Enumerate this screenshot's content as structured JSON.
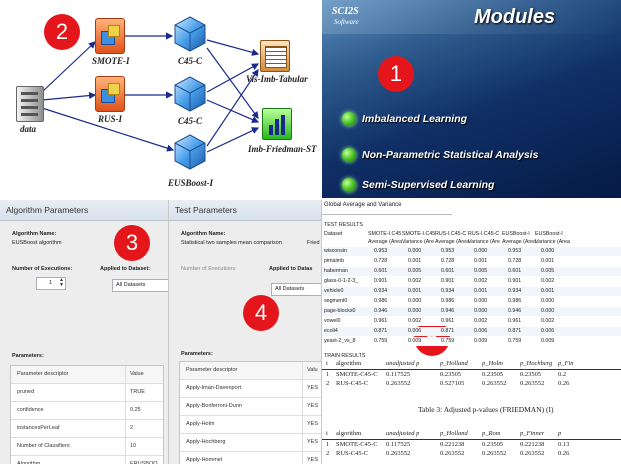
{
  "badges": [
    "2",
    "1",
    "3",
    "4",
    "5"
  ],
  "workflow": {
    "nodes": {
      "data": "data",
      "smote": "SMOTE-I",
      "rus": "RUS-I",
      "c45_top": "C45-C",
      "c45_mid": "C45-C",
      "eusboost": "EUSBoost-I",
      "vis_tabular": "Vis-Imb-Tabular",
      "friedman": "Imb-Friedman-ST"
    }
  },
  "modules": {
    "logo_line1": "SCI2S",
    "logo_line2": "Software",
    "title": "Modules",
    "items": [
      "Imbalanced Learning",
      "Non-Parametric Statistical Analysis",
      "Semi-Supervised Learning"
    ],
    "colors": {
      "bg": "#0f2f66",
      "dot": "#52c92a"
    }
  },
  "algo_dialog": {
    "title": "Algorithm Parameters",
    "name_label": "Algorithm Name:",
    "name_value": "EUSBoost algorithm",
    "executions_label": "Number of Executions:",
    "executions_value": "1",
    "applied_label": "Applied to Dataset:",
    "applied_value": "All Datasets",
    "params_label": "Parameters:",
    "headers": [
      "Parameter descriptor",
      "Value"
    ],
    "rows": [
      [
        "pruned",
        "TRUE"
      ],
      [
        "confidence",
        "0.25"
      ],
      [
        "instancesPerLeaf",
        "2"
      ],
      [
        "Number of Classifiers",
        "10"
      ],
      [
        "Algorithm",
        "ERUSBOO"
      ]
    ]
  },
  "test_dialog": {
    "title": "Test Parameters",
    "name_label": "Algorithm Name:",
    "name_value": "Statistical two samples mean comparison",
    "name_value_cut": "Fried",
    "executions_label": "Number of Executions:",
    "applied_label": "Applied to Datas",
    "applied_value": "All Datasets",
    "params_label": "Parameters:",
    "headers": [
      "Parameter descriptor",
      "Valu"
    ],
    "rows": [
      [
        "Apply-Iman-Davenport",
        "YES"
      ],
      [
        "Apply-Bonferroni-Dunn",
        "YES"
      ],
      [
        "Apply-Holm",
        "YES"
      ],
      [
        "Apply-Hochberg",
        "YES"
      ],
      [
        "Apply-Hommel",
        "YES"
      ]
    ]
  },
  "results": {
    "title": "Global Average and Variance",
    "test_results_label": "TEST RESULTS",
    "header1": [
      "Dataset",
      "SMOTE-I.C45",
      "SMOTE-I.C45",
      "RUS-I.C45-C",
      "RUS-I.C45-C",
      "EUSBoost-I",
      "EUSBoost-I"
    ],
    "header2": [
      "",
      "Average (Area",
      "Variance (Are",
      "Average (Area",
      "Variance (Are",
      "Average (Area",
      "Variance (Area"
    ],
    "rows": [
      [
        "wisconsin",
        "0.953",
        "0.000",
        "0.953",
        "0.000",
        "0.953",
        "0.000"
      ],
      [
        "pimaimb",
        "0.728",
        "0.001",
        "0.728",
        "0.001",
        "0.728",
        "0.001"
      ],
      [
        "haberman",
        "0.601",
        "0.005",
        "0.601",
        "0.005",
        "0.601",
        "0.005"
      ],
      [
        "glass-0-1-2-3_",
        "0.901",
        "0.002",
        "0.901",
        "0.002",
        "0.901",
        "0.002"
      ],
      [
        "vehicle0",
        "0.934",
        "0.001",
        "0.934",
        "0.001",
        "0.934",
        "0.001"
      ],
      [
        "segment0",
        "0.986",
        "0.000",
        "0.986",
        "0.000",
        "0.986",
        "0.000"
      ],
      [
        "page-blocks0",
        "0.946",
        "0.000",
        "0.946",
        "0.000",
        "0.946",
        "0.000"
      ],
      [
        "vowel0",
        "0.961",
        "0.002",
        "0.961",
        "0.002",
        "0.961",
        "0.002"
      ],
      [
        "ecoli4",
        "0.871",
        "0.006",
        "0.871",
        "0.006",
        "0.871",
        "0.006"
      ],
      [
        "yeast-2_vs_8",
        "0.759",
        "0.009",
        "0.759",
        "0.009",
        "0.759",
        "0.009"
      ]
    ],
    "train_label": "TRAIN RESULTS",
    "table_a_header": [
      "i",
      "algorithm",
      "unadjusted p",
      "p_Holland",
      "p_Holm",
      "p_Hochberg",
      "p_Fin"
    ],
    "table_a_rows": [
      [
        "1",
        "SMOTE-C45-C",
        "0.117525",
        "0.23505",
        "0.23505",
        "0.23505",
        "0.2"
      ],
      [
        "2",
        "RUS-C45-C",
        "0.263552",
        "0.527105",
        "0.263552",
        "0.263552",
        "0.26"
      ]
    ],
    "caption": "Table 3: Adjusted p-values (FRIEDMAN) (I)",
    "table_b_header": [
      "i",
      "algorithm",
      "unadjusted p",
      "p_Holland",
      "p_Rom",
      "p_Finner",
      "p"
    ],
    "table_b_rows": [
      [
        "1",
        "SMOTE-C45-C",
        "0.117525",
        "0.221238",
        "0.23505",
        "0.221238",
        "0.13"
      ],
      [
        "2",
        "RUS-C45-C",
        "0.263552",
        "0.263552",
        "0.263552",
        "0.263552",
        "0.26"
      ]
    ]
  }
}
